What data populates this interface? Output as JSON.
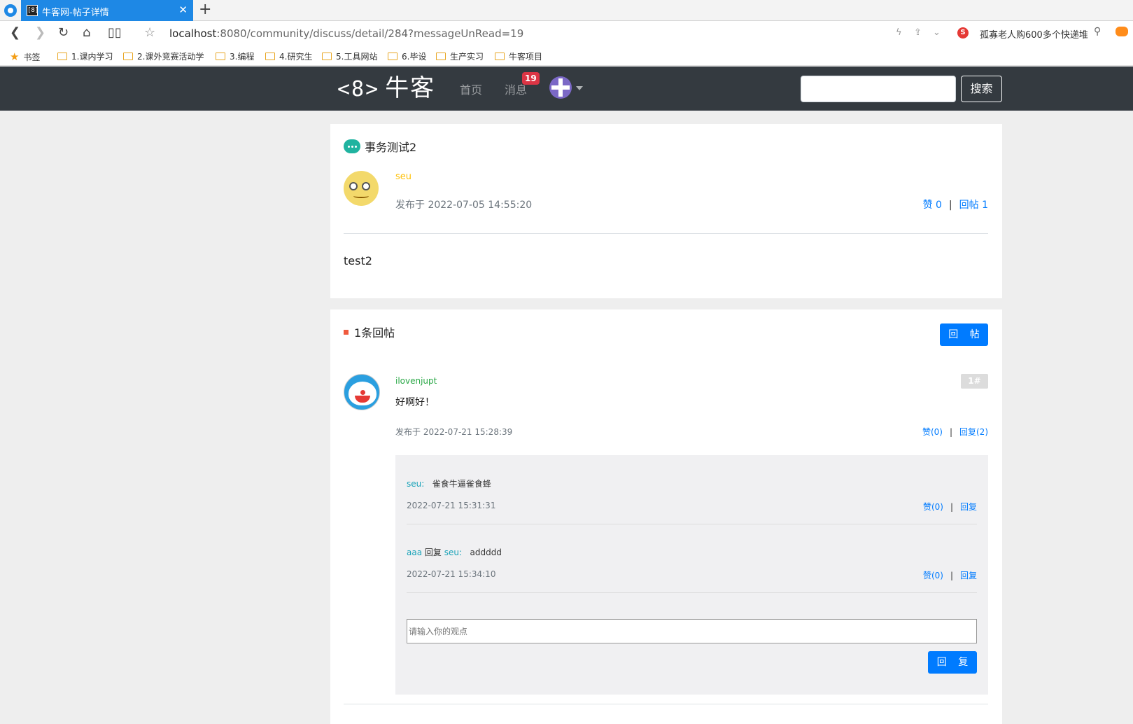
{
  "browser": {
    "tab_title": "牛客网-帖子详情",
    "tab_favicon": "[8]",
    "new_tab": "+",
    "url_host": "localhost",
    "url_rest": ":8080/community/discuss/detail/284?messageUnRead=19",
    "news_text": "孤寡老人购600多个快递堆",
    "bookmarks": [
      "书签",
      "1.课内学习",
      "2.课外竞赛活动学",
      "3.编程",
      "4.研究生",
      "5.工具网站",
      "6.毕设",
      "生产实习",
      "牛客项目"
    ]
  },
  "header": {
    "logo_mark": "<8>",
    "logo_text": "牛客",
    "nav_home": "首页",
    "nav_messages": "消息",
    "unread_count": "19",
    "search_value": "",
    "search_button": "搜索"
  },
  "post": {
    "title": "事务测试2",
    "author": "seu",
    "time": "发布于 2022-07-05 14:55:20",
    "likes": "赞 0",
    "replies": "回帖 1",
    "separator": "|",
    "content": "test2"
  },
  "comments_section": {
    "heading": "1条回帖",
    "reply_post_button": "回 帖",
    "comment": {
      "user": "ilovenjupt",
      "floor": "1#",
      "text": "好啊好！",
      "time": "发布于 2022-07-21 15:28:39",
      "likes": "赞(0)",
      "replies": "回复(2)",
      "separator": "|"
    },
    "replies": [
      {
        "user": "seu:",
        "reply_word": "",
        "target": "",
        "text": "雀食牛逼雀食蜂",
        "time": "2022-07-21 15:31:31",
        "likes": "赞(0)",
        "reply": "回复"
      },
      {
        "user": "aaa",
        "reply_word": "回复",
        "target": "seu:",
        "text": "addddd",
        "time": "2022-07-21 15:34:10",
        "likes": "赞(0)",
        "reply": "回复"
      }
    ],
    "reply_input_placeholder": "请输入你的观点",
    "reply_button": "回 复"
  }
}
